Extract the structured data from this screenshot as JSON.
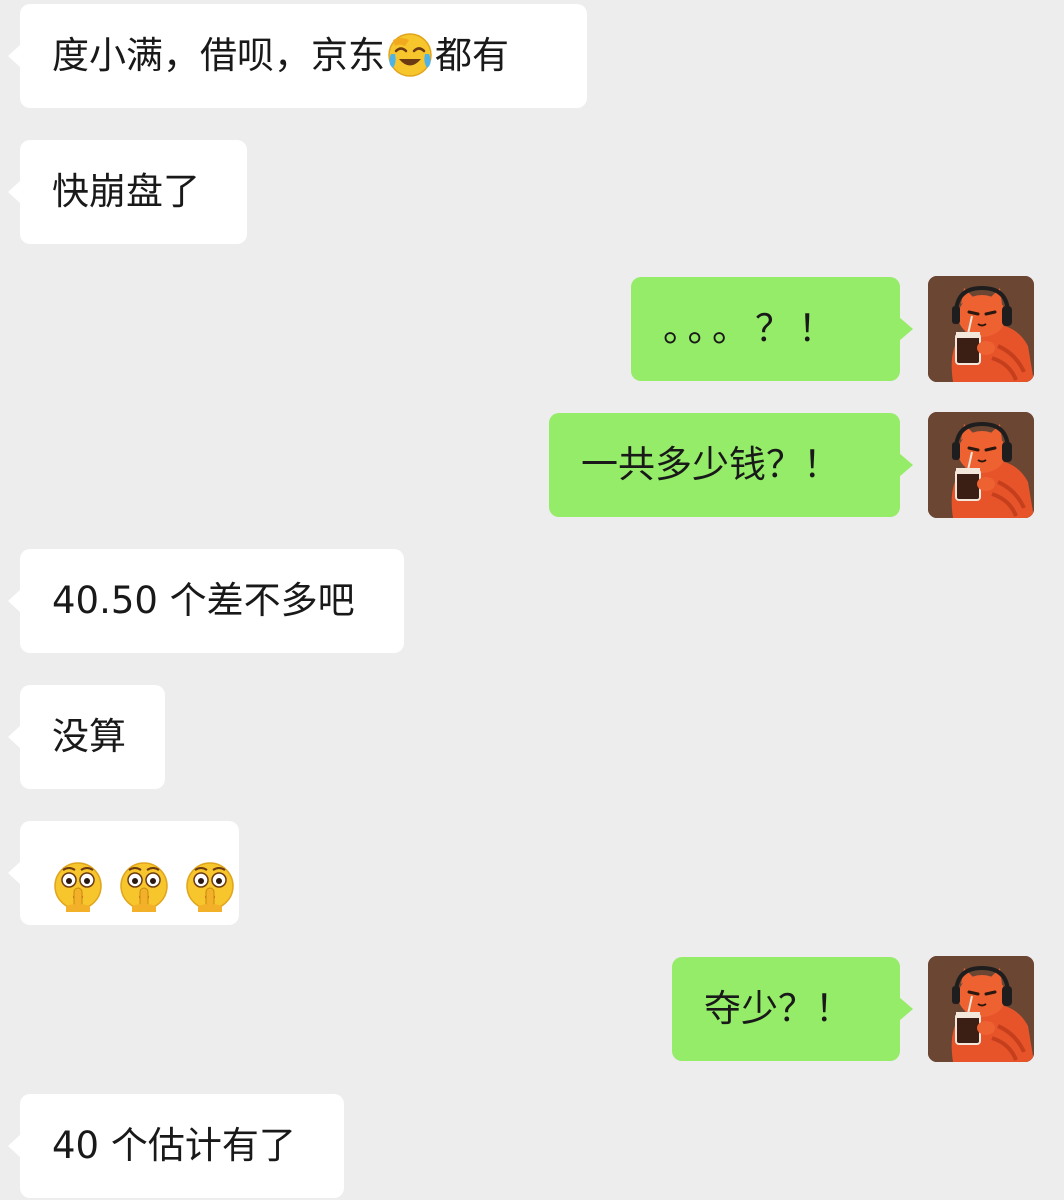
{
  "messages": [
    {
      "side": "in",
      "text_before": "度小满，借呗，京东",
      "emoji": "laughing-crying-face-icon",
      "text_after": "都有"
    },
    {
      "side": "in",
      "text": "快崩盘了"
    },
    {
      "side": "out",
      "text": "。。。？！",
      "avatar": "orange-cat-avatar-icon"
    },
    {
      "side": "out",
      "text": "一共多少钱？！",
      "avatar": "orange-cat-avatar-icon"
    },
    {
      "side": "in",
      "text": "40.50 个差不多吧"
    },
    {
      "side": "in",
      "text": "没算"
    },
    {
      "side": "in",
      "emojis": [
        "shushing-face-icon",
        "shushing-face-icon",
        "shushing-face-icon"
      ]
    },
    {
      "side": "out",
      "text": "夺少？！",
      "avatar": "orange-cat-avatar-icon"
    },
    {
      "side": "in",
      "text": "40 个估计有了"
    }
  ],
  "colors": {
    "background": "#ededed",
    "incoming_bubble": "#ffffff",
    "outgoing_bubble": "#95ec69",
    "text": "#191919"
  }
}
